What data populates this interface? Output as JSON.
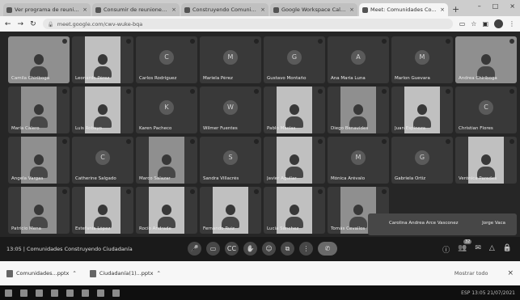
{
  "browser": {
    "tabs": [
      {
        "title": "Ver programa de reunión",
        "active": false
      },
      {
        "title": "Consumir de reuniones - Correo",
        "active": false
      },
      {
        "title": "Construyendo Comunidades",
        "active": false
      },
      {
        "title": "Google Workspace Calendar",
        "active": false
      },
      {
        "title": "Meet: Comunidades Co...",
        "active": true
      }
    ],
    "url": "meet.google.com/cwv-wuke-bqa"
  },
  "participants": [
    {
      "name": "Camila Chiriboga",
      "camera": "wide"
    },
    {
      "name": "Leonardo Pérez",
      "camera": "light"
    },
    {
      "name": "Carlos Rodríguez",
      "initial": "C"
    },
    {
      "name": "Mariela Pérez",
      "initial": "M"
    },
    {
      "name": "Gustavo Montaño",
      "initial": "G"
    },
    {
      "name": "Ana María Luna",
      "initial": "A"
    },
    {
      "name": "Marlon Guevara",
      "initial": "M"
    },
    {
      "name": "Andrea Chiriboga",
      "camera": "wide"
    },
    {
      "name": "María Calero",
      "camera": "on"
    },
    {
      "name": "Luis Robayo",
      "camera": "light"
    },
    {
      "name": "Karen Pacheco",
      "initial": "K"
    },
    {
      "name": "Wilmer Fuentes",
      "initial": "W"
    },
    {
      "name": "Pablo Macías",
      "camera": "light"
    },
    {
      "name": "Diego Benavides",
      "camera": "on"
    },
    {
      "name": "Juan Espinoza",
      "camera": "light"
    },
    {
      "name": "Christian Flores",
      "initial": "C"
    },
    {
      "name": "Ángela Vargas",
      "camera": "on"
    },
    {
      "name": "Catherine Salgado",
      "initial": "C"
    },
    {
      "name": "Marco Salazar",
      "camera": "on"
    },
    {
      "name": "Sandra Villacrés",
      "initial": "S"
    },
    {
      "name": "Javier Aguilar",
      "camera": "light"
    },
    {
      "name": "Mónica Arévalo",
      "initial": "M"
    },
    {
      "name": "Gabriela Ortiz",
      "initial": "G"
    },
    {
      "name": "Verónica Paredes",
      "camera": "light"
    },
    {
      "name": "Patricio Mena",
      "camera": "on"
    },
    {
      "name": "Estefanía López",
      "camera": "light"
    },
    {
      "name": "Rocío Andrade",
      "camera": "light"
    },
    {
      "name": "Fernando Ruiz",
      "camera": "light"
    },
    {
      "name": "Lucía Sánchez",
      "camera": "light"
    },
    {
      "name": "Tomás Cevallos",
      "camera": "on"
    }
  ],
  "big_tile": {
    "name": "Carolina Andrea Arce Vasconez",
    "name2": "Jorge Vaca"
  },
  "meeting": {
    "info": "13:05  |  Comunidades Construyendo Ciudadanía"
  },
  "controls": {
    "mic": "🎤",
    "cam": "▭",
    "cc": "CC",
    "hand": "✋",
    "emoji": "☺",
    "present": "⧉",
    "more": "⋮",
    "leave": "✆",
    "info": "ⓘ",
    "people": "👥",
    "people_count": "32",
    "chat": "✉",
    "activities": "△",
    "lock": "🔒"
  },
  "downloads": [
    {
      "name": "Comunidades...pptx"
    },
    {
      "name": "Ciudadanía(1)...pptx"
    }
  ],
  "downloads_show_all": "Mostrar todo",
  "taskbar": {
    "tray": "ESP  13:05  21/07/2021"
  }
}
